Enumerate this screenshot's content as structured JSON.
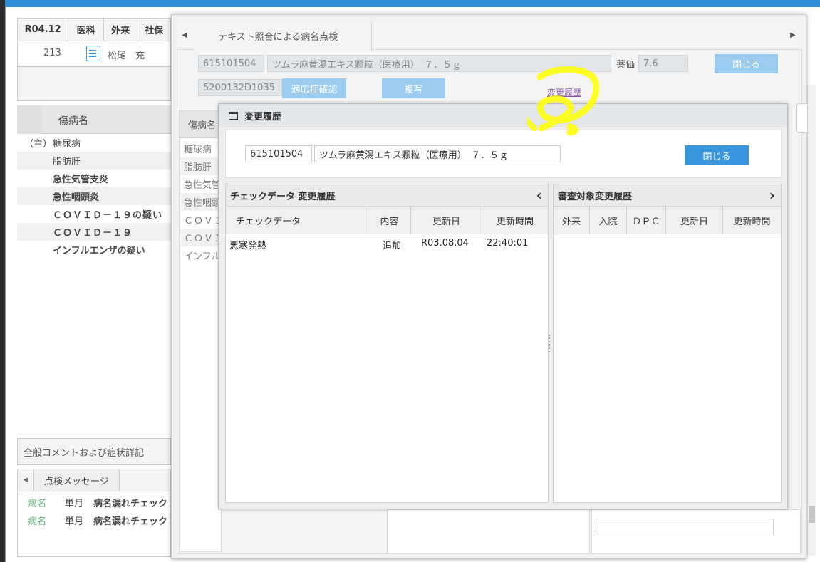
{
  "bg": {
    "header_cells": [
      "R04.12",
      "医科",
      "外来",
      "社保"
    ],
    "patient_no": "213",
    "patient_name": "松尾　充",
    "disease_col": "傷病名",
    "diseases": [
      {
        "prefix": "（主）",
        "name": "糖尿病",
        "bold": false
      },
      {
        "prefix": "",
        "name": "脂肪肝",
        "bold": false
      },
      {
        "prefix": "",
        "name": "急性気管支炎",
        "bold": true
      },
      {
        "prefix": "",
        "name": "急性咽頭炎",
        "bold": true
      },
      {
        "prefix": "",
        "name": "ＣＯＶＩＤ－１９の疑い",
        "bold": true
      },
      {
        "prefix": "",
        "name": "ＣＯＶＩＤ－１９",
        "bold": true
      },
      {
        "prefix": "",
        "name": "インフルエンザの疑い",
        "bold": true
      }
    ],
    "comment_label": "全般コメントおよび症状詳記",
    "msg_tab": "点検メッセージ",
    "messages": [
      {
        "kind": "病名",
        "period": "単月",
        "text": "病名漏れチェック"
      },
      {
        "kind": "病名",
        "period": "単月",
        "text": "病名漏れチェック"
      }
    ],
    "mid_col_head": "傷病名",
    "mid_list": [
      "糖尿病",
      "脂肪肝",
      "急性気管",
      "急性咽頭",
      "ＣＯＶＩ",
      "ＣＯＶＩ",
      "インフル"
    ]
  },
  "outer": {
    "tab_label": "テキスト照合による病名点検",
    "drug_code": "615101504",
    "drug_name": "ツムラ麻黄湯エキス顆粒（医療用）　７．５ｇ",
    "price_label": "薬価",
    "price_value": "7.6",
    "close_label": "閉じる",
    "code2": "5200132D1035",
    "indication_btn": "適応症確認",
    "copy_btn": "複写",
    "history_link": "変更履歴",
    "arrow_left": "◀",
    "arrow_right": "▶"
  },
  "dialog": {
    "title": "変更履歴",
    "drug_code": "615101504",
    "drug_name": "ツムラ麻黄湯エキス顆粒（医療用）　７．５ｇ",
    "close_label": "閉じる",
    "left_panel": {
      "title": "チェックデータ 変更履歴",
      "collapse": "‹",
      "columns": [
        "チェックデータ",
        "内容",
        "更新日",
        "更新時間"
      ],
      "rows": [
        {
          "data": "悪寒発熱",
          "content": "追加",
          "date": "R03.08.04",
          "time": "22:40:01"
        }
      ]
    },
    "right_panel": {
      "title": "審査対象変更履歴",
      "expand": "›",
      "columns": [
        "外来",
        "入院",
        "ＤＰＣ",
        "更新日",
        "更新時間"
      ],
      "rows": []
    }
  },
  "colors": {
    "accent_blue": "#3a97dd",
    "light_blue": "#9bcbee",
    "highlight": "#ffff00",
    "link_purple": "#8a5aa8"
  }
}
